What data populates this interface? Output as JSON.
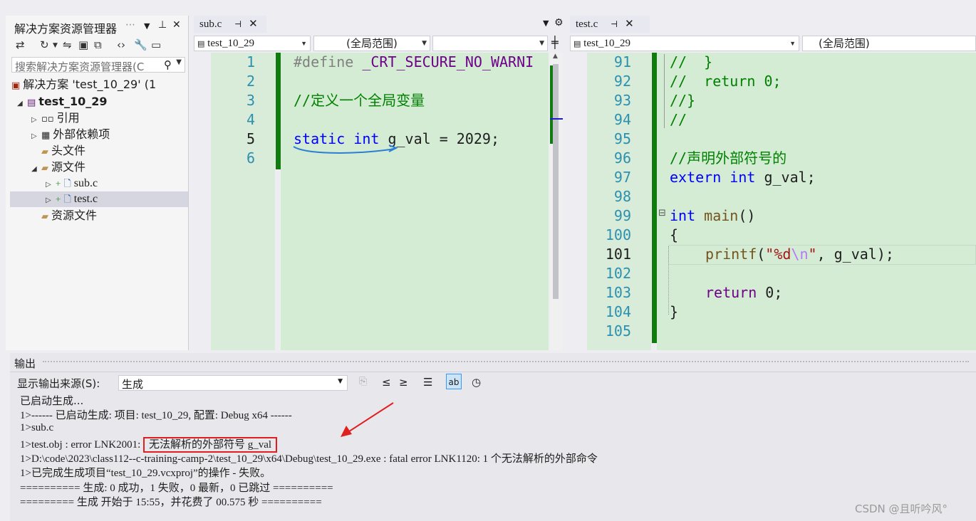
{
  "solution_explorer": {
    "title": "解决方案资源管理器",
    "search_placeholder": "搜索解决方案资源管理器(C",
    "tree": [
      {
        "label": "解决方案 'test_10_29' (1",
        "icon": "solution-icon"
      },
      {
        "label": "test_10_29",
        "icon": "project-icon"
      },
      {
        "label": "引用",
        "icon": "references-icon"
      },
      {
        "label": "外部依赖项",
        "icon": "external-deps-icon"
      },
      {
        "label": "头文件",
        "icon": "folder-icon"
      },
      {
        "label": "源文件",
        "icon": "folder-icon"
      },
      {
        "label": "sub.c",
        "icon": "c-file-icon"
      },
      {
        "label": "test.c",
        "icon": "c-file-icon"
      },
      {
        "label": "资源文件",
        "icon": "folder-icon"
      }
    ]
  },
  "editor_left": {
    "tab": "sub.c",
    "nav_project": "test_10_29",
    "nav_scope": "(全局范围)",
    "lines": [
      "1",
      "2",
      "3",
      "4",
      "5",
      "6"
    ],
    "code": {
      "l1_pp": "#define ",
      "l1_macro": "_CRT_SECURE_NO_WARNI",
      "l3_comment": "//定义一个全局变量",
      "l5_static": "static",
      "l5_int": "int",
      "l5_rest": " g_val = 2029;"
    }
  },
  "editor_right": {
    "tab": "test.c",
    "nav_project": "test_10_29",
    "nav_scope": "(全局范围)",
    "lines": [
      "91",
      "92",
      "93",
      "94",
      "95",
      "96",
      "97",
      "98",
      "99",
      "100",
      "101",
      "102",
      "103",
      "104",
      "105"
    ],
    "code": {
      "l91": "//  }",
      "l92": "//  return 0;",
      "l93": "//}",
      "l94": "//",
      "l96": "//声明外部符号的",
      "l97_extern": "extern",
      "l97_int": "int",
      "l97_rest": " g_val;",
      "l99_int": "int",
      "l99_main": "main",
      "l99_rest": "()",
      "l100": "{",
      "l101_fn": "printf",
      "l101_open": "(",
      "l101_str1": "\"%d",
      "l101_esc": "\\n",
      "l101_str2": "\"",
      "l101_rest": ", g_val);",
      "l103_kw": "return",
      "l103_rest": " 0;",
      "l104": "}"
    }
  },
  "output": {
    "title": "输出",
    "source_label": "显示输出来源(S):",
    "source_value": "生成",
    "lines": [
      "已启动生成...",
      "1>------ 已启动生成: 项目: test_10_29, 配置: Debug x64 ------",
      "1>sub.c",
      "1>test.obj : error LNK2001: ",
      "1>D:\\code\\2023\\class112--c-training-camp-2\\test_10_29\\x64\\Debug\\test_10_29.exe : fatal error LNK1120: 1 个无法解析的外部命令",
      "1>已完成生成项目“test_10_29.vcxproj”的操作 - 失败。",
      "========== 生成: 0 成功，1 失败，0 最新，0 已跳过 ==========",
      "========= 生成 开始于 15:55，并花费了 00.575 秒 =========="
    ],
    "error_highlight": "无法解析的外部符号 g_val"
  },
  "watermark": "CSDN @且听吟风°",
  "colors": {
    "keyword": "#0000ff",
    "comment": "#008000",
    "macro": "#6f008a",
    "string": "#a31515",
    "highlight": "#e02020"
  }
}
